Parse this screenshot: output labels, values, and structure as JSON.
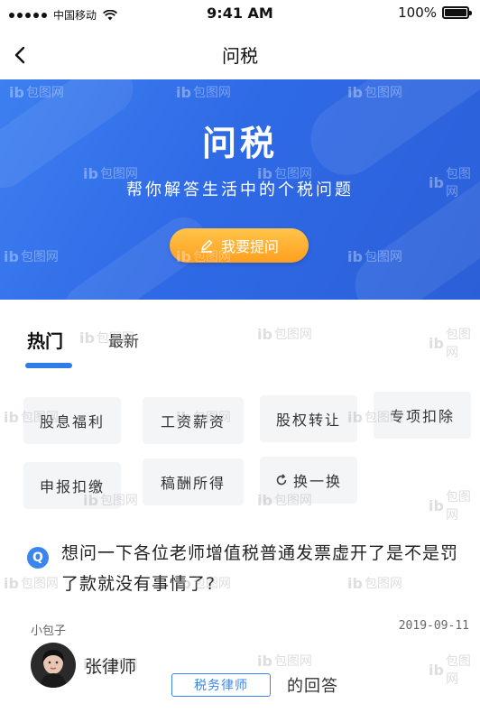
{
  "status_bar": {
    "carrier": "中国移动",
    "time": "9:41 AM",
    "battery_percent": "100%"
  },
  "nav": {
    "title": "问税"
  },
  "banner": {
    "title": "问税",
    "subtitle": "帮你解答生活中的个税问题",
    "ask_button_label": "我要提问"
  },
  "tabs": [
    {
      "label": "热门",
      "active": true
    },
    {
      "label": "最新",
      "active": false
    }
  ],
  "tags": [
    "股息福利",
    "工资薪资",
    "股权转让",
    "专项扣除",
    "申报扣缴",
    "稿酬所得"
  ],
  "refresh_label": "换一换",
  "question": {
    "icon_letter": "Q",
    "text": "想问一下各位老师增值税普通发票虚开了是不是罚了款就没有事情了?",
    "author": "小包子",
    "date": "2019-09-11"
  },
  "answer": {
    "name": "张律师",
    "role": "税务律师",
    "suffix": "的回答"
  },
  "watermark": {
    "mark": "ib",
    "text": "包图网"
  },
  "colors": {
    "accent": "#2f7be8",
    "banner_start": "#3d7ff0",
    "banner_end": "#2b5fd8",
    "button_start": "#ffc54a",
    "button_end": "#ff9f1f",
    "tag_bg": "#f4f5f7"
  }
}
